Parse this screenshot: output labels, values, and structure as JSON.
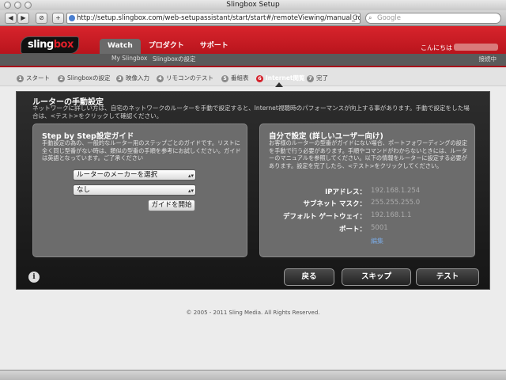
{
  "browser": {
    "title": "Slingbox Setup",
    "back_label": "◀",
    "forward_label": "▶",
    "tab_label": "⊘",
    "add_label": "+",
    "url": "http://setup.slingbox.com/web-setupassistant/start/start#/remoteViewing/manual_router_n",
    "reload_label": "C",
    "search_placeholder": "Google"
  },
  "header": {
    "logo_sling": "sling",
    "logo_box": "box",
    "nav": [
      "Watch",
      "プロダクト",
      "サポート"
    ],
    "subnav": [
      "My Slingbox",
      "Slingboxの設定"
    ],
    "greeting": "こんにちは",
    "logout": "接続中"
  },
  "steps": [
    {
      "num": "1",
      "label": "スタート"
    },
    {
      "num": "2",
      "label": "Slingboxの設定"
    },
    {
      "num": "3",
      "label": "映像入力"
    },
    {
      "num": "4",
      "label": "リモコンのテスト"
    },
    {
      "num": "5",
      "label": "番組表"
    },
    {
      "num": "6",
      "label": "Internet閲覧"
    },
    {
      "num": "7",
      "label": "完了"
    }
  ],
  "main": {
    "title": "ルーターの手動設定",
    "description": "ネットワークに詳しい方は、自宅のネットワークのルーターを手動で設定すると、Internet視聴時のパフォーマンスが向上する事があります。手動で設定をした場合は、<テスト>をクリックして確認ください。",
    "left": {
      "title": "Step by Step設定ガイド",
      "description": "手動設定の為の、一般的なルーター用のステップごとのガイドです。リストに全く同じ型番がない時は、類似の型番の手順を参考にお試しください。ガイドは英語となっています。ご了承ください",
      "maker_select": "ルーターのメーカーを選択",
      "model_select": "なし",
      "start_button": "ガイドを開始"
    },
    "right": {
      "title": "自分で設定 (詳しいユーザー向け)",
      "description": "お客様のルーターの型番がガイドにない場合、ポートフォワーディングの設定を手動で行う必要があります。手順やコマンドがわからないときには、ルーターのマニュアルを参照してください。以下の情報をルーターに設定する必要があります。設定を完了したら、<テスト>をクリックしてください。",
      "fields": [
        {
          "label": "IPアドレス：",
          "value": "192.168.1.254"
        },
        {
          "label": "サブネット マスク：",
          "value": "255.255.255.0"
        },
        {
          "label": "デフォルト ゲートウェイ：",
          "value": "192.168.1.1"
        },
        {
          "label": "ポート：",
          "value": "5001"
        }
      ],
      "edit_label": "編集"
    },
    "info_label": "i",
    "buttons": {
      "back": "戻る",
      "skip": "スキップ",
      "test": "テスト"
    }
  },
  "footer": {
    "copyright": "© 2005 - 2011 Sling Media. All Rights Reserved."
  },
  "colors": {
    "brand_red": "#d4202a",
    "panel": "#6c6c6c",
    "value_gray": "#aaaaaa",
    "link_blue": "#7aa8e0"
  }
}
